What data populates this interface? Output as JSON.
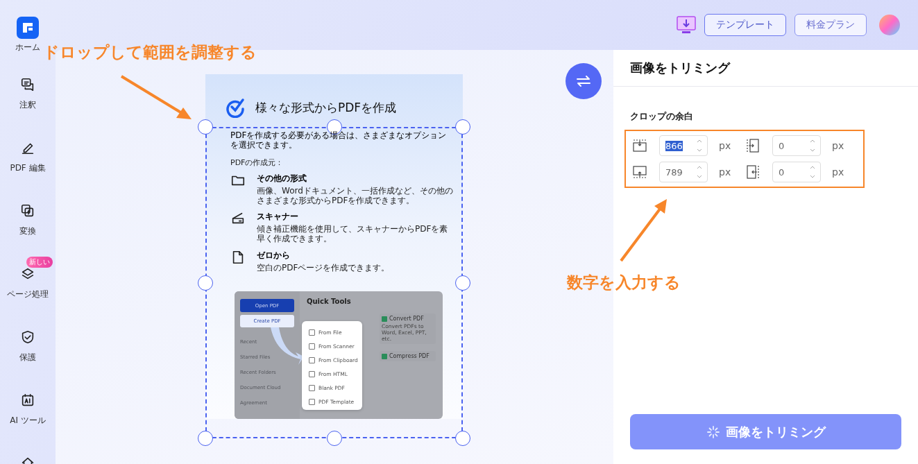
{
  "sidebar": {
    "logo_label": "ホーム",
    "items": [
      {
        "kind": "comment",
        "label": "注釈"
      },
      {
        "kind": "edit",
        "label": "PDF 編集"
      },
      {
        "kind": "convert",
        "label": "変換"
      },
      {
        "kind": "pages",
        "label": "ページ処理",
        "badge": "新しい"
      },
      {
        "kind": "protect",
        "label": "保護"
      },
      {
        "kind": "ai",
        "label": "AI ツール"
      },
      {
        "kind": "home"
      }
    ]
  },
  "header": {
    "buttons": [
      "テンプレート",
      "料金プラン"
    ]
  },
  "annotations": [
    "ドロップして範囲を調整する",
    "数字を入力する"
  ],
  "document": {
    "title": "様々な形式からPDFを作成",
    "intro": "PDFを作成する必要がある場合は、さまざまなオプションを選択できます。",
    "section": "PDFの作成元：",
    "options": [
      {
        "kind": "folder",
        "title": "その他の形式",
        "description": "画像、Wordドキュメント、一括作成など、その他のさまざまな形式からPDFを作成できます。"
      },
      {
        "kind": "scanner",
        "title": "スキャナー",
        "description": "傾き補正機能を使用して、スキャナーからPDFを素早く作成できます。"
      },
      {
        "kind": "blank",
        "title": "ゼロから",
        "description": "空白のPDFページを作成できます。"
      }
    ],
    "mini_app": {
      "open_button": "Open PDF",
      "create_button": "Create PDF",
      "nav": [
        "Recent",
        "Starred Files",
        "Recent Folders",
        "Document Cloud",
        "Agreement"
      ],
      "heading": "Quick Tools",
      "tools": [
        {
          "title": "Convert PDF",
          "description": "Convert PDFs to Word, Excel, PPT, etc."
        },
        {
          "title": "Compress PDF"
        }
      ],
      "menu": [
        "From File",
        "From Scanner",
        "From Clipboard",
        "From HTML",
        "Blank PDF",
        "PDF Template"
      ]
    }
  },
  "panel": {
    "title": "画像をトリミング",
    "section": "クロップの余白",
    "margins": [
      {
        "kind": "top",
        "value": "866",
        "unit": "px",
        "highlighted": true
      },
      {
        "kind": "left",
        "value": "0",
        "unit": "px",
        "highlighted": false
      },
      {
        "kind": "bottom",
        "value": "789",
        "unit": "px",
        "highlighted": false
      },
      {
        "kind": "right",
        "value": "0",
        "unit": "px",
        "highlighted": false
      }
    ],
    "action": "画像をトリミング"
  }
}
